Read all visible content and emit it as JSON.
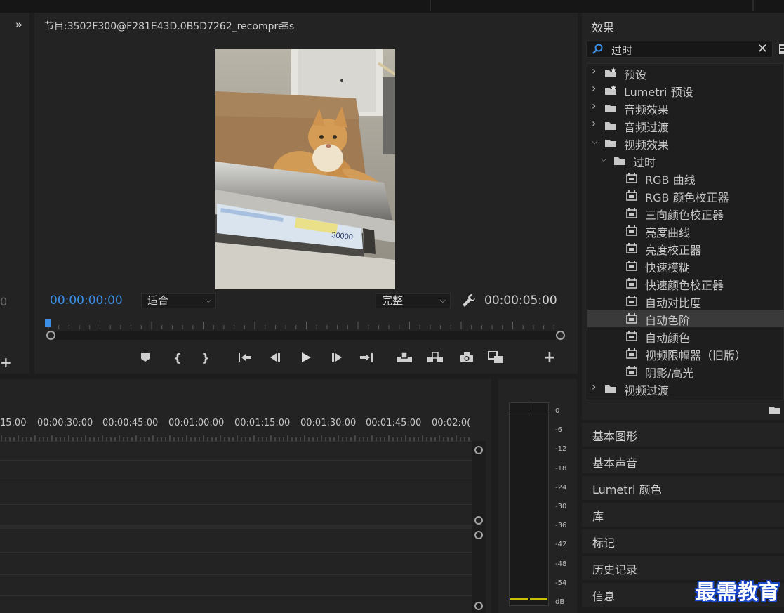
{
  "program_monitor": {
    "title": "节目:3502F300@F281E43D.0B5D7262_recompress",
    "current_timecode": "00:00:00:00",
    "duration_timecode": "00:00:05:00",
    "zoom_select": "适合",
    "quality_select": "完整",
    "video_overlay_text": "30000"
  },
  "left_panel": {
    "expand_glyph": "»",
    "partial_text": "0",
    "add_glyph": "+"
  },
  "timeline": {
    "ruler_labels": [
      "15:00",
      "00:00:30:00",
      "00:00:45:00",
      "00:01:00:00",
      "00:01:15:00",
      "00:01:30:00",
      "00:01:45:00",
      "00:02:0("
    ]
  },
  "audio_meter": {
    "scale": [
      "0",
      "-6",
      "-12",
      "-18",
      "-24",
      "-30",
      "-36",
      "-42",
      "-48",
      "-54",
      "dB"
    ]
  },
  "effects_panel": {
    "title": "效果",
    "search_value": "过时",
    "tree": [
      {
        "label": "预设",
        "kind": "preset-bin",
        "level": 0,
        "expanded": false
      },
      {
        "label": "Lumetri 预设",
        "kind": "preset-bin",
        "level": 0,
        "expanded": false
      },
      {
        "label": "音频效果",
        "kind": "folder",
        "level": 0,
        "expanded": false
      },
      {
        "label": "音频过渡",
        "kind": "folder",
        "level": 0,
        "expanded": false
      },
      {
        "label": "视频效果",
        "kind": "folder",
        "level": 0,
        "expanded": true
      },
      {
        "label": "过时",
        "kind": "folder",
        "level": 1,
        "expanded": true
      },
      {
        "label": "RGB 曲线",
        "kind": "effect",
        "level": 2
      },
      {
        "label": "RGB 颜色校正器",
        "kind": "effect",
        "level": 2
      },
      {
        "label": "三向颜色校正器",
        "kind": "effect",
        "level": 2
      },
      {
        "label": "亮度曲线",
        "kind": "effect",
        "level": 2
      },
      {
        "label": "亮度校正器",
        "kind": "effect",
        "level": 2
      },
      {
        "label": "快速模糊",
        "kind": "effect",
        "level": 2
      },
      {
        "label": "快速颜色校正器",
        "kind": "effect",
        "level": 2
      },
      {
        "label": "自动对比度",
        "kind": "effect",
        "level": 2
      },
      {
        "label": "自动色阶",
        "kind": "effect",
        "level": 2,
        "selected": true
      },
      {
        "label": "自动颜色",
        "kind": "effect",
        "level": 2
      },
      {
        "label": "视频限幅器（旧版）",
        "kind": "effect",
        "level": 2
      },
      {
        "label": "阴影/高光",
        "kind": "effect",
        "level": 2
      },
      {
        "label": "视频过渡",
        "kind": "folder",
        "level": 0,
        "expanded": false
      }
    ]
  },
  "collapsed_panels": [
    "基本图形",
    "基本声音",
    "Lumetri 颜色",
    "库",
    "标记",
    "历史记录",
    "信息"
  ],
  "watermark": "最需教育",
  "colors": {
    "timecode_blue": "#3b8fe6",
    "panel_bg": "#232323",
    "selected_row": "#3a3a3a",
    "meter_level": "#c8c000"
  }
}
